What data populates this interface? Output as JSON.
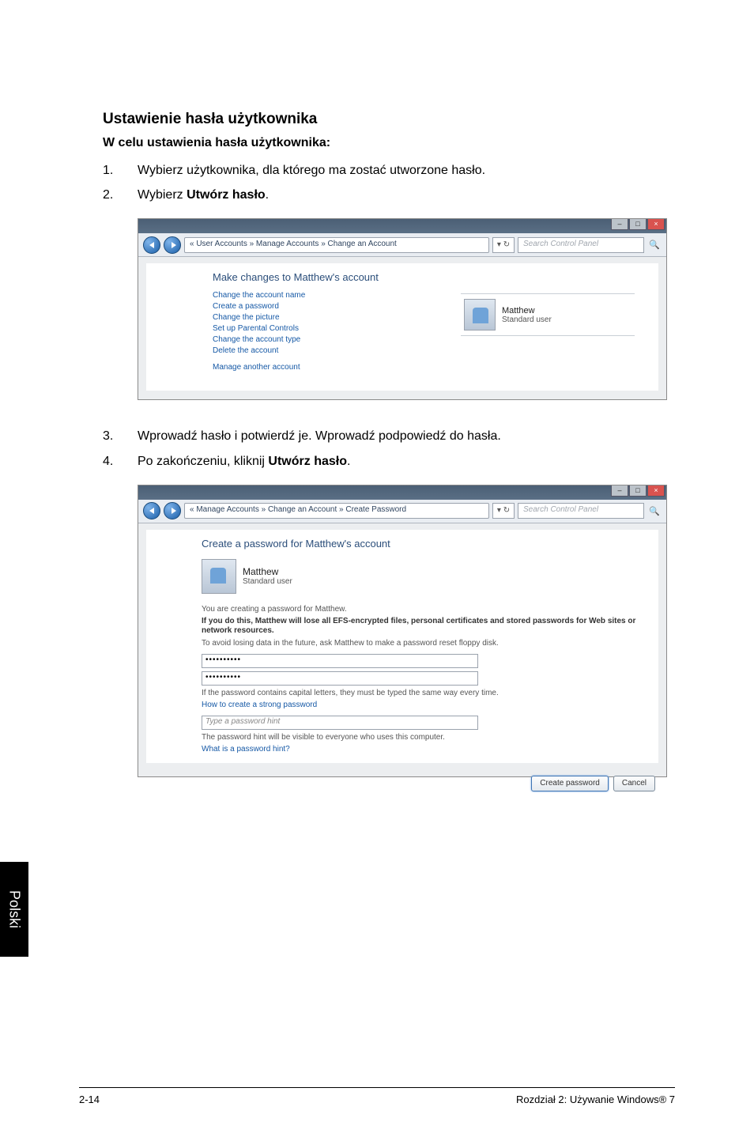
{
  "page": {
    "section_title": "Ustawienie hasła użytkownika",
    "subheading": "W celu ustawienia hasła użytkownika:",
    "step1_num": "1.",
    "step1_txt": "Wybierz użytkownika, dla którego ma zostać utworzone hasło.",
    "step2_num": "2.",
    "step2_pre": "Wybierz ",
    "step2_bold": "Utwórz hasło",
    "step2_post": ".",
    "step3_num": "3.",
    "step3_txt": "Wprowadź hasło i potwierdź je. Wprowadź podpowiedź do hasła.",
    "step4_num": "4.",
    "step4_pre": "Po zakończeniu, kliknij ",
    "step4_bold": "Utwórz hasło",
    "step4_post": "."
  },
  "ss1": {
    "breadcrumb": "« User Accounts » Manage Accounts » Change an Account",
    "refresh": "▾ ↻",
    "search_placeholder": "Search Control Panel",
    "panel_title": "Make changes to Matthew's account",
    "links": [
      "Change the account name",
      "Create a password",
      "Change the picture",
      "Set up Parental Controls",
      "Change the account type",
      "Delete the account"
    ],
    "link_manage": "Manage another account",
    "user_name": "Matthew",
    "user_type": "Standard user"
  },
  "ss2": {
    "breadcrumb": "« Manage Accounts » Change an Account » Create Password",
    "refresh": "▾ ↻",
    "search_placeholder": "Search Control Panel",
    "panel_title": "Create a password for Matthew's account",
    "user_name": "Matthew",
    "user_type": "Standard user",
    "creating": "You are creating a password for Matthew.",
    "warn": "If you do this, Matthew will lose all EFS-encrypted files, personal certificates and stored passwords for Web sites or network resources.",
    "avoid": "To avoid losing data in the future, ask Matthew to make a password reset floppy disk.",
    "pw1": "••••••••••",
    "pw2": "••••••••••",
    "capnote": "If the password contains capital letters, they must be typed the same way every time.",
    "howto": "How to create a strong password",
    "hint_placeholder": "Type a password hint",
    "hint_note": "The password hint will be visible to everyone who uses this computer.",
    "whatis": "What is a password hint?",
    "btn_create": "Create password",
    "btn_cancel": "Cancel"
  },
  "sidetab": "Polski",
  "footer": {
    "left": "2-14",
    "right": "Rozdział 2: Używanie Windows® 7"
  }
}
